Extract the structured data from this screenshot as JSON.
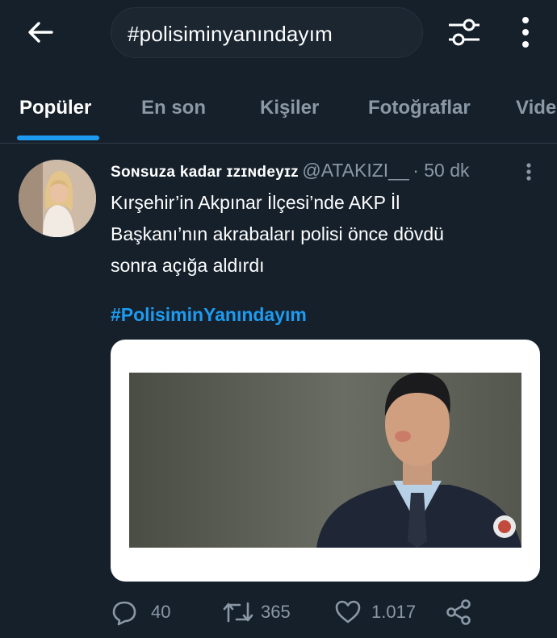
{
  "search": {
    "query": "#polisiminyanındayım"
  },
  "tabs": [
    {
      "label": "Popüler"
    },
    {
      "label": "En son"
    },
    {
      "label": "Kişiler"
    },
    {
      "label": "Fotoğraflar"
    },
    {
      "label": "Vide"
    }
  ],
  "tweet": {
    "display_name": "Sᴏɴsuza kadar ɪzɪɴdeyɪz",
    "handle": "@ATAKIZI__",
    "time": "· 50 dk",
    "text_lines": [
      "Kırşehir’in Akpınar İlçesi’nde AKP İl",
      "Başkanı’nın akrabaları polisi önce dövdü",
      "sonra açığa aldırdı"
    ],
    "hashtag": "#PolisiminYanındayım",
    "replies": "40",
    "retweets": "365",
    "likes": "1.017"
  },
  "colors": {
    "background": "#15202b",
    "accent": "#1d9bf0",
    "muted": "#8b98a5"
  }
}
